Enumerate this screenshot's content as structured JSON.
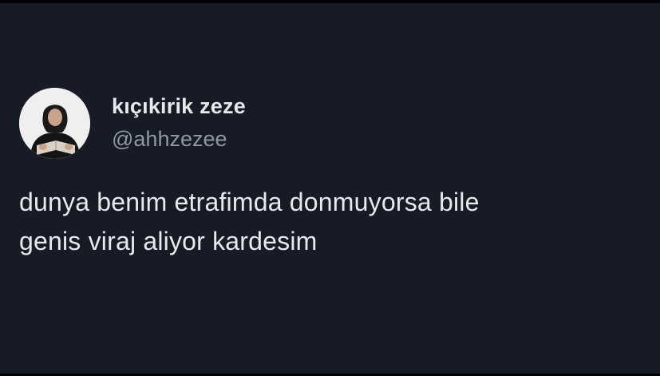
{
  "tweet": {
    "author": {
      "display_name": "kıçıkirik zeze",
      "handle": "@ahhzezee",
      "avatar": "profile-photo"
    },
    "text_lines": [
      "dunya benim etrafimda donmuyorsa bile",
      "genis viraj aliyor kardesim"
    ]
  },
  "colors": {
    "background": "#161b25",
    "primary_text": "#e7e9ea",
    "secondary_text": "#8b98a5"
  }
}
